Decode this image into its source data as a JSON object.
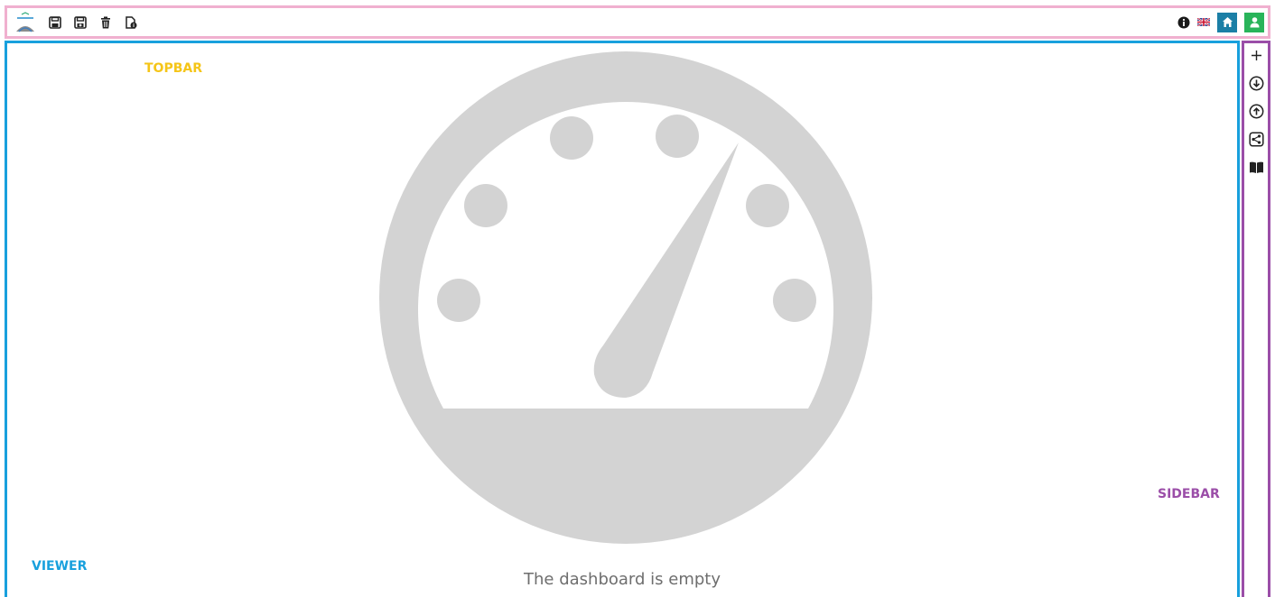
{
  "topbar": {
    "left_icons": [
      "app-logo-icon",
      "save-icon",
      "save-as-icon",
      "trash-icon",
      "file-info-icon"
    ],
    "right_icons": [
      "info-icon",
      "flag-icon",
      "home-icon",
      "user-icon"
    ],
    "home_button_color": "#1b7fa6",
    "user_button_color": "#29b45a"
  },
  "labels": {
    "topbar": "TOPBAR",
    "viewer": "VIEWER",
    "sidebar": "SIDEBAR"
  },
  "label_colors": {
    "topbar": "#f5c518",
    "viewer": "#18a0dd",
    "sidebar": "#9b4ea8"
  },
  "viewer": {
    "empty_message": "The dashboard is empty",
    "placeholder_icon": "dashboard-gauge-icon",
    "placeholder_color": "#d3d3d3"
  },
  "sidebar": {
    "icons": [
      "plus-icon",
      "download-icon",
      "upload-icon",
      "share-icon",
      "book-icon"
    ]
  },
  "frame_colors": {
    "topbar": "#f0b0cf",
    "viewer": "#18a0dd",
    "sidebar": "#9b4ea8"
  }
}
